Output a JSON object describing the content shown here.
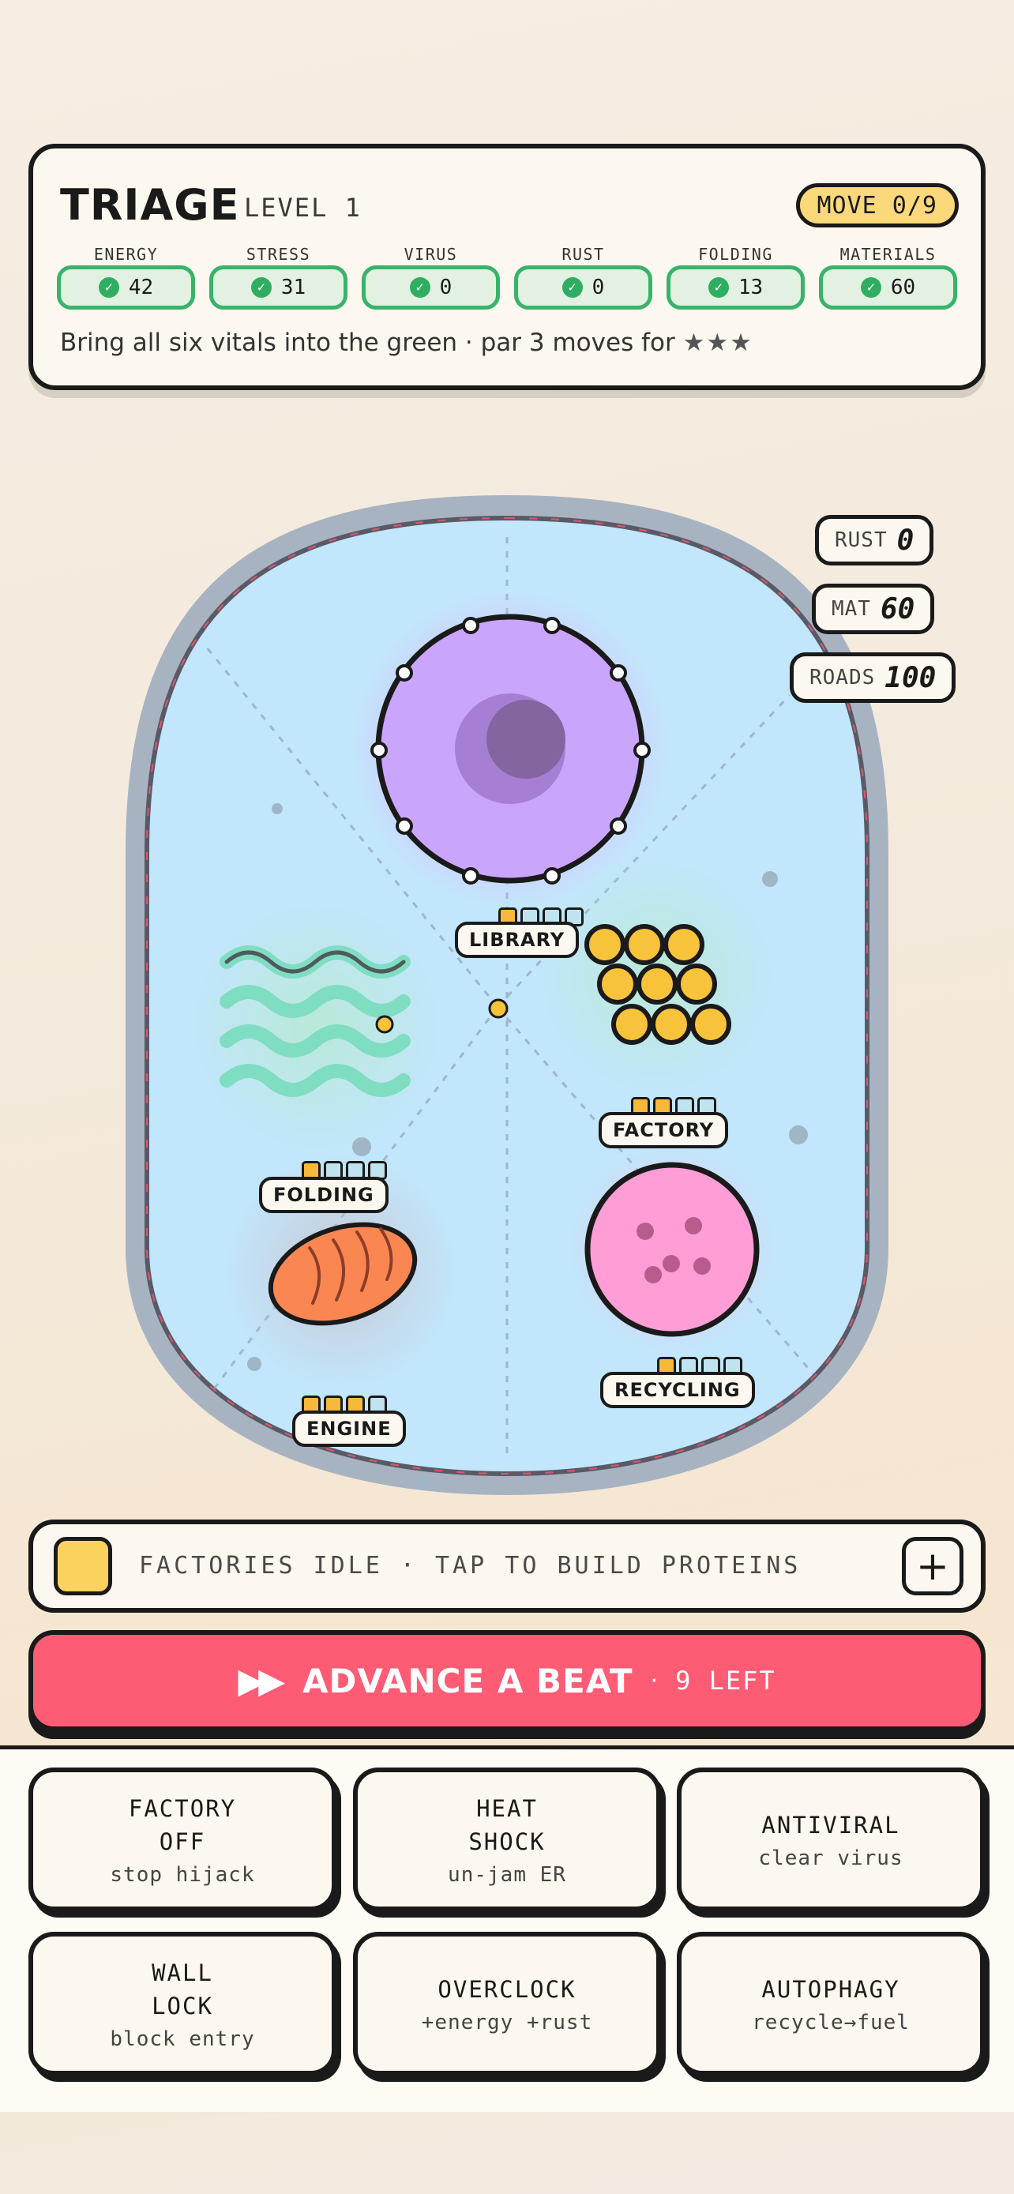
{
  "header": {
    "title": "TRIAGE",
    "level": "LEVEL 1",
    "move": "MOVE 0/9",
    "hint": "Bring all six vitals into the green · par 3 moves for",
    "stars": "★★★"
  },
  "vitals": [
    {
      "label": "ENERGY",
      "value": "42",
      "status": "green"
    },
    {
      "label": "STRESS",
      "value": "31",
      "status": "green"
    },
    {
      "label": "VIRUS",
      "value": "0",
      "status": "green"
    },
    {
      "label": "RUST",
      "value": "0",
      "status": "green"
    },
    {
      "label": "FOLDING",
      "value": "13",
      "status": "green"
    },
    {
      "label": "MATERIALS",
      "value": "60",
      "status": "green"
    }
  ],
  "stats": [
    {
      "key": "RUST",
      "value": "0"
    },
    {
      "key": "MAT",
      "value": "60"
    },
    {
      "key": "ROADS",
      "value": "100"
    }
  ],
  "organelles": {
    "library": {
      "label": "LIBRARY",
      "filled": 1,
      "slots": 4
    },
    "factory": {
      "label": "FACTORY",
      "filled": 2,
      "slots": 4
    },
    "folding": {
      "label": "FOLDING",
      "filled": 1,
      "slots": 4
    },
    "engine": {
      "label": "ENGINE",
      "filled": 3,
      "slots": 4
    },
    "recycling": {
      "label": "RECYCLING",
      "filled": 1,
      "slots": 4
    }
  },
  "build": {
    "text": "FACTORIES IDLE · TAP TO BUILD PROTEINS",
    "plus": "+"
  },
  "advance": {
    "label": "ADVANCE A BEAT",
    "sep": "·",
    "left": "9 LEFT"
  },
  "actions": [
    {
      "name": "FACTORY\nOFF",
      "sub": "stop hijack"
    },
    {
      "name": "HEAT\nSHOCK",
      "sub": "un-jam ER"
    },
    {
      "name": "ANTIVIRAL",
      "sub": "clear virus"
    },
    {
      "name": "WALL\nLOCK",
      "sub": "block entry"
    },
    {
      "name": "OVERCLOCK",
      "sub": "+energy +rust"
    },
    {
      "name": "AUTOPHAGY",
      "sub": "recycle→fuel"
    }
  ],
  "colors": {
    "ok_green": "#38b36a",
    "accent_yellow": "#fbd879",
    "advance_red": "#fe5b75",
    "cytoplasm": "#c2e6fb",
    "nucleus": "#c9a6fb"
  },
  "icons": [
    "check-icon",
    "fast-forward-icon",
    "plus-icon"
  ]
}
